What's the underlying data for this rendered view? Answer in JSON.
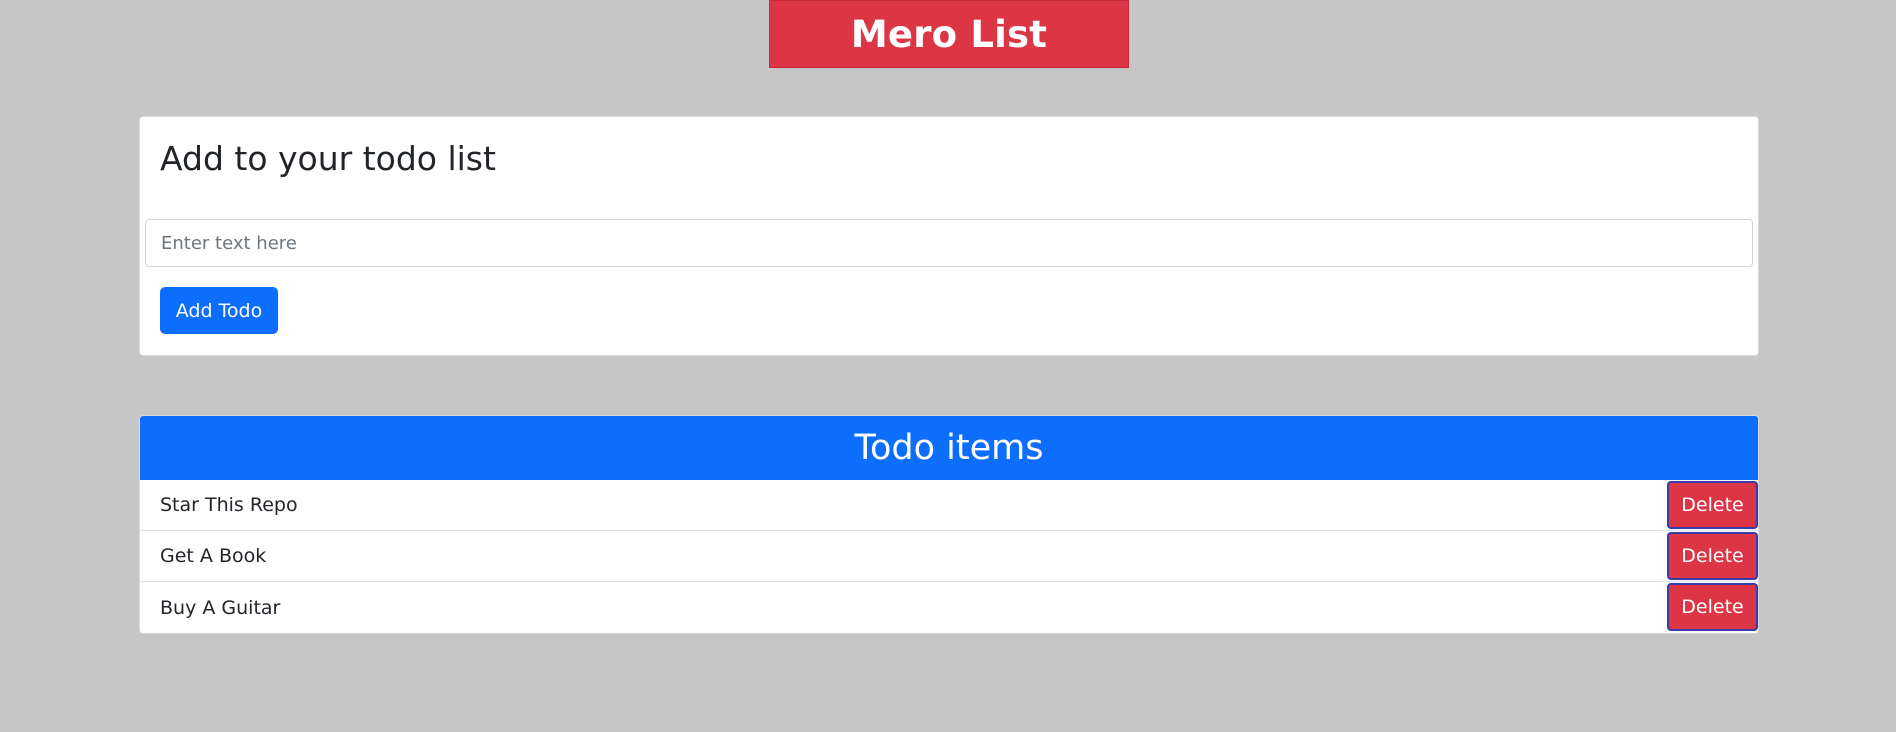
{
  "brand": {
    "title": "Mero List"
  },
  "add_form": {
    "heading": "Add to your todo list",
    "input_placeholder": "Enter text here",
    "input_value": "",
    "button_label": "Add Todo"
  },
  "todo_list": {
    "heading": "Todo items",
    "items": [
      {
        "text": "Star This Repo",
        "delete_label": "Delete"
      },
      {
        "text": "Get A Book",
        "delete_label": "Delete"
      },
      {
        "text": "Buy A Guitar",
        "delete_label": "Delete"
      }
    ]
  },
  "colors": {
    "background": "#c6c6c6",
    "brand_red": "#dc3545",
    "primary_blue": "#0d6efd",
    "card_white": "#ffffff"
  }
}
